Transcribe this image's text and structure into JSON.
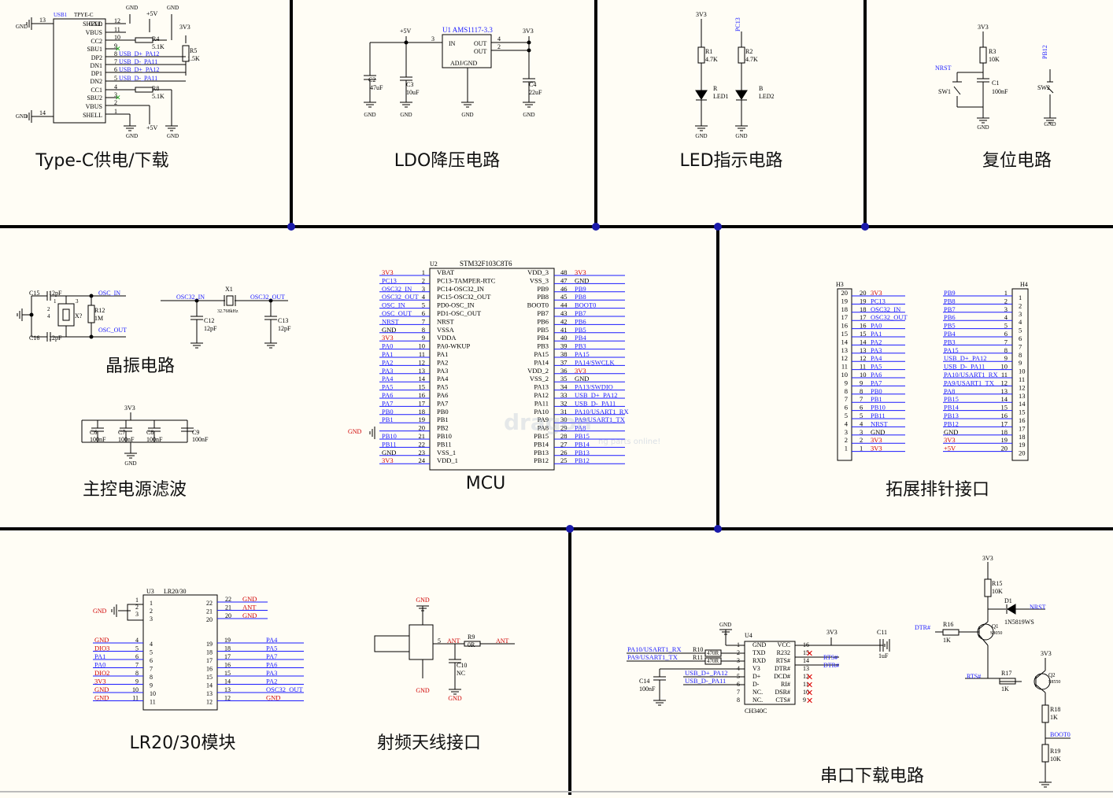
{
  "sections": {
    "typec": "Type-C供电/下载",
    "ldo": "LDO降压电路",
    "led": "LED指示电路",
    "reset": "复位电路",
    "crystal": "晶振电路",
    "mcu": "MCU",
    "header": "拓展排针接口",
    "filter": "主控电源滤波",
    "lr": "LR20/30模块",
    "rf": "射频天线接口",
    "serial": "串口下载电路"
  },
  "watermark": {
    "brand": "dragon",
    "tagline": "ng parts online!"
  },
  "typec": {
    "ref": "USB1",
    "part": "TPYE-C",
    "left_pins": [
      "SHELL",
      "VBUS",
      "CC2",
      "SBU1",
      "DP2",
      "DN1",
      "DP1",
      "DN2",
      "CC1",
      "SBU2",
      "VBUS",
      "SHELL"
    ],
    "right_pins": [
      "GND",
      "",
      "",
      "",
      "",
      "",
      "",
      "",
      "",
      "",
      "",
      "GND"
    ],
    "pin_nums": [
      "12",
      "11",
      "10",
      "9",
      "8",
      "7",
      "6",
      "5",
      "4",
      "3",
      "2",
      "1"
    ],
    "nets": [
      "",
      "",
      "",
      "",
      "USB_D+_PA12",
      "USB_D-_PA11",
      "USB_D+_PA12",
      "USB_D-_PA11",
      "",
      "",
      "",
      ""
    ],
    "gnd": "GND",
    "v5": "+5V",
    "v33": "3V3",
    "r4": "R4",
    "r4v": "5.1K",
    "r8": "R8",
    "r8v": "5.1K",
    "r5": "R5",
    "r5v": "1.5K",
    "shell_pins": [
      "13",
      "14"
    ]
  },
  "ldo": {
    "ref": "U1",
    "part": "AMS1117-3.3",
    "pins": [
      "IN",
      "OUT",
      "OUT",
      "ADJ/GND"
    ],
    "pin_nums": [
      "3",
      "4",
      "2"
    ],
    "v5": "+5V",
    "v33": "3V3",
    "c2": "C2",
    "c2v": "47uF",
    "c3": "C3",
    "c3v": "10uF",
    "c4": "C4",
    "c4v": "22uF",
    "gnd": "GND"
  },
  "led": {
    "v33": "3V3",
    "pc13": "PC13",
    "r1": "R1",
    "r1v": "4.7K",
    "r2": "R2",
    "r2v": "4.7K",
    "led1": "LED1",
    "led1c": "R",
    "led2": "LED2",
    "led2c": "B",
    "gnd": "GND"
  },
  "reset": {
    "v33": "3V3",
    "r3": "R3",
    "r3v": "10K",
    "nrst": "NRST",
    "sw1": "SW1",
    "c1": "C1",
    "c1v": "100nF",
    "pb12": "PB12",
    "sw2": "SW2",
    "gnd": "GND"
  },
  "crystal": {
    "c15": "C15",
    "c15v": "12pF",
    "c16": "C16",
    "c16v": "12pF",
    "x2": "X?",
    "r12": "R12",
    "r12v": "1M",
    "osc_in": "OSC_IN",
    "osc_out": "OSC_OUT",
    "pins": [
      "1",
      "2",
      "3",
      "4"
    ],
    "x1": "X1",
    "x1v": "32.768kHz",
    "osc32_in": "OSC32_IN",
    "osc32_out": "OSC32_OUT",
    "c12": "C12",
    "c12v": "12pF",
    "c13": "C13",
    "c13v": "12pF"
  },
  "filter": {
    "v33": "3V3",
    "gnd": "GND",
    "caps": [
      {
        "ref": "C6",
        "val": "100nF"
      },
      {
        "ref": "C7",
        "val": "100nF"
      },
      {
        "ref": "C8",
        "val": "100nF"
      },
      {
        "ref": "C9",
        "val": "100nF"
      }
    ]
  },
  "mcu": {
    "ref": "U2",
    "part": "STM32F103C8T6",
    "gnd": "GND",
    "left": [
      {
        "net": "3V3",
        "num": "1",
        "pin": "VBAT",
        "c": "red"
      },
      {
        "net": "PC13",
        "num": "2",
        "pin": "PC13-TAMPER-RTC",
        "c": "blue"
      },
      {
        "net": "OSC32_IN",
        "num": "3",
        "pin": "PC14-OSC32_IN",
        "c": "blue"
      },
      {
        "net": "OSC32_OUT",
        "num": "4",
        "pin": "PC15-OSC32_OUT",
        "c": "blue"
      },
      {
        "net": "OSC_IN",
        "num": "5",
        "pin": "PD0-OSC_IN",
        "c": "blue"
      },
      {
        "net": "OSC_OUT",
        "num": "6",
        "pin": "PD1-OSC_OUT",
        "c": "blue"
      },
      {
        "net": "NRST",
        "num": "7",
        "pin": "NRST",
        "c": "blue"
      },
      {
        "net": "GND",
        "num": "8",
        "pin": "VSSA",
        "c": "blk"
      },
      {
        "net": "3V3",
        "num": "9",
        "pin": "VDDA",
        "c": "red"
      },
      {
        "net": "PA0",
        "num": "10",
        "pin": "PA0-WKUP",
        "c": "blue"
      },
      {
        "net": "PA1",
        "num": "11",
        "pin": "PA1",
        "c": "blue"
      },
      {
        "net": "PA2",
        "num": "12",
        "pin": "PA2",
        "c": "blue"
      },
      {
        "net": "PA3",
        "num": "13",
        "pin": "PA3",
        "c": "blue"
      },
      {
        "net": "PA4",
        "num": "14",
        "pin": "PA4",
        "c": "blue"
      },
      {
        "net": "PA5",
        "num": "15",
        "pin": "PA5",
        "c": "blue"
      },
      {
        "net": "PA6",
        "num": "16",
        "pin": "PA6",
        "c": "blue"
      },
      {
        "net": "PA7",
        "num": "17",
        "pin": "PA7",
        "c": "blue"
      },
      {
        "net": "PB0",
        "num": "18",
        "pin": "PB0",
        "c": "blue"
      },
      {
        "net": "PB1",
        "num": "19",
        "pin": "PB1",
        "c": "blue"
      },
      {
        "net": "",
        "num": "20",
        "pin": "PB2",
        "c": "blk"
      },
      {
        "net": "PB10",
        "num": "21",
        "pin": "PB10",
        "c": "blue"
      },
      {
        "net": "PB11",
        "num": "22",
        "pin": "PB11",
        "c": "blue"
      },
      {
        "net": "GND",
        "num": "23",
        "pin": "VSS_1",
        "c": "blk"
      },
      {
        "net": "3V3",
        "num": "24",
        "pin": "VDD_1",
        "c": "red"
      }
    ],
    "right": [
      {
        "net": "3V3",
        "num": "48",
        "pin": "VDD_3",
        "c": "red"
      },
      {
        "net": "GND",
        "num": "47",
        "pin": "VSS_3",
        "c": "blk"
      },
      {
        "net": "PB9",
        "num": "46",
        "pin": "PB9",
        "c": "blue"
      },
      {
        "net": "PB8",
        "num": "45",
        "pin": "PB8",
        "c": "blue"
      },
      {
        "net": "BOOT0",
        "num": "44",
        "pin": "BOOT0",
        "c": "blue"
      },
      {
        "net": "PB7",
        "num": "43",
        "pin": "PB7",
        "c": "blue"
      },
      {
        "net": "PB6",
        "num": "42",
        "pin": "PB6",
        "c": "blue"
      },
      {
        "net": "PB5",
        "num": "41",
        "pin": "PB5",
        "c": "blue"
      },
      {
        "net": "PB4",
        "num": "40",
        "pin": "PB4",
        "c": "blue"
      },
      {
        "net": "PB3",
        "num": "39",
        "pin": "PB3",
        "c": "blue"
      },
      {
        "net": "PA15",
        "num": "38",
        "pin": "PA15",
        "c": "blue"
      },
      {
        "net": "PA14/SWCLK",
        "num": "37",
        "pin": "PA14",
        "c": "blue"
      },
      {
        "net": "3V3",
        "num": "36",
        "pin": "VDD_2",
        "c": "red"
      },
      {
        "net": "GND",
        "num": "35",
        "pin": "VSS_2",
        "c": "blk"
      },
      {
        "net": "PA13/SWDIO",
        "num": "34",
        "pin": "PA13",
        "c": "blue"
      },
      {
        "net": "USB_D+_PA12",
        "num": "33",
        "pin": "PA12",
        "c": "blue"
      },
      {
        "net": "USB_D-_PA11",
        "num": "32",
        "pin": "PA11",
        "c": "blue"
      },
      {
        "net": "PA10/USART1_RX",
        "num": "31",
        "pin": "PA10",
        "c": "blue"
      },
      {
        "net": "PA9/USART1_TX",
        "num": "30",
        "pin": "PA9",
        "c": "blue"
      },
      {
        "net": "PA8",
        "num": "29",
        "pin": "PA8",
        "c": "blue"
      },
      {
        "net": "PB15",
        "num": "28",
        "pin": "PB15",
        "c": "blue"
      },
      {
        "net": "PB14",
        "num": "27",
        "pin": "PB14",
        "c": "blue"
      },
      {
        "net": "PB13",
        "num": "26",
        "pin": "PB13",
        "c": "blue"
      },
      {
        "net": "PB12",
        "num": "25",
        "pin": "PB12",
        "c": "blue"
      }
    ]
  },
  "header": {
    "h3": "H3",
    "h4": "H4",
    "h3_rows": [
      {
        "n": "20",
        "net": "3V3",
        "c": "red"
      },
      {
        "n": "19",
        "net": "PC13",
        "c": "blue"
      },
      {
        "n": "18",
        "net": "OSC32_IN",
        "c": "blue"
      },
      {
        "n": "17",
        "net": "OSC32_OUT",
        "c": "blue"
      },
      {
        "n": "16",
        "net": "PA0",
        "c": "blue"
      },
      {
        "n": "15",
        "net": "PA1",
        "c": "blue"
      },
      {
        "n": "14",
        "net": "PA2",
        "c": "blue"
      },
      {
        "n": "13",
        "net": "PA3",
        "c": "blue"
      },
      {
        "n": "12",
        "net": "PA4",
        "c": "blue"
      },
      {
        "n": "11",
        "net": "PA5",
        "c": "blue"
      },
      {
        "n": "10",
        "net": "PA6",
        "c": "blue"
      },
      {
        "n": "9",
        "net": "PA7",
        "c": "blue"
      },
      {
        "n": "8",
        "net": "PB0",
        "c": "blue"
      },
      {
        "n": "7",
        "net": "PB1",
        "c": "blue"
      },
      {
        "n": "6",
        "net": "PB10",
        "c": "blue"
      },
      {
        "n": "5",
        "net": "PB11",
        "c": "blue"
      },
      {
        "n": "4",
        "net": "NRST",
        "c": "blue"
      },
      {
        "n": "3",
        "net": "GND",
        "c": "blk"
      },
      {
        "n": "2",
        "net": "3V3",
        "c": "red"
      },
      {
        "n": "1",
        "net": "3V3",
        "c": "red"
      }
    ],
    "h4_rows": [
      {
        "n": "1",
        "net": "PB9",
        "c": "blue"
      },
      {
        "n": "2",
        "net": "PB8",
        "c": "blue"
      },
      {
        "n": "3",
        "net": "PB7",
        "c": "blue"
      },
      {
        "n": "4",
        "net": "PB6",
        "c": "blue"
      },
      {
        "n": "5",
        "net": "PB5",
        "c": "blue"
      },
      {
        "n": "6",
        "net": "PB4",
        "c": "blue"
      },
      {
        "n": "7",
        "net": "PB3",
        "c": "blue"
      },
      {
        "n": "8",
        "net": "PA15",
        "c": "blue"
      },
      {
        "n": "9",
        "net": "USB_D+_PA12",
        "c": "blue"
      },
      {
        "n": "10",
        "net": "USB_D-_PA11",
        "c": "blue"
      },
      {
        "n": "11",
        "net": "PA10/USART1_RX",
        "c": "blue"
      },
      {
        "n": "12",
        "net": "PA9/USART1_TX",
        "c": "blue"
      },
      {
        "n": "13",
        "net": "PA8",
        "c": "blue"
      },
      {
        "n": "14",
        "net": "PB15",
        "c": "blue"
      },
      {
        "n": "15",
        "net": "PB14",
        "c": "blue"
      },
      {
        "n": "16",
        "net": "PB13",
        "c": "blue"
      },
      {
        "n": "17",
        "net": "PB12",
        "c": "blue"
      },
      {
        "n": "18",
        "net": "GND",
        "c": "blk"
      },
      {
        "n": "19",
        "net": "3V3",
        "c": "red"
      },
      {
        "n": "20",
        "net": "+5V",
        "c": "red"
      }
    ]
  },
  "lr": {
    "ref": "U3",
    "part": "LR20/30",
    "gnd": "GND",
    "top_left": [
      "1",
      "2",
      "3"
    ],
    "top_right": [
      {
        "n": "22",
        "net": "GND"
      },
      {
        "n": "21",
        "net": "ANT"
      },
      {
        "n": "20",
        "net": "GND"
      }
    ],
    "left": [
      {
        "net": "GND",
        "n": "4",
        "c": "red"
      },
      {
        "net": "DIO3",
        "n": "5",
        "c": "red"
      },
      {
        "net": "PA1",
        "n": "6",
        "c": "blue"
      },
      {
        "net": "PA0",
        "n": "7",
        "c": "blue"
      },
      {
        "net": "DIO2",
        "n": "8",
        "c": "red"
      },
      {
        "net": "3V3",
        "n": "9",
        "c": "red"
      },
      {
        "net": "GND",
        "n": "10",
        "c": "red"
      },
      {
        "net": "GND",
        "n": "11",
        "c": "red"
      }
    ],
    "right": [
      {
        "net": "PA4",
        "n": "19",
        "c": "blue"
      },
      {
        "net": "PA5",
        "n": "18",
        "c": "blue"
      },
      {
        "net": "PA7",
        "n": "17",
        "c": "blue"
      },
      {
        "net": "PA6",
        "n": "16",
        "c": "blue"
      },
      {
        "net": "PA3",
        "n": "15",
        "c": "blue"
      },
      {
        "net": "PA2",
        "n": "14",
        "c": "blue"
      },
      {
        "net": "OSC32_OUT",
        "n": "13",
        "c": "blue"
      },
      {
        "net": "GND",
        "n": "12",
        "c": "red"
      }
    ]
  },
  "rf": {
    "gnd": "GND",
    "ant": "ANT",
    "r9": "R9",
    "r9v": "0R",
    "c10": "C10",
    "c10v": "NC",
    "pin5": "5"
  },
  "serial": {
    "ref": "U4",
    "part": "CH340C",
    "gnd": "GND",
    "v33": "3V3",
    "c11": "C11",
    "c11v": "1uF",
    "c14": "C14",
    "c14v": "100nF",
    "r10": "R10",
    "r11": "R11",
    "r10v": "470R",
    "r11v": "470R",
    "left_nets": [
      "PA10/USART1_RX",
      "PA9/USART1_TX",
      "USB_D+_PA12",
      "USB_D-_PA11"
    ],
    "left_pins": [
      {
        "n": "1",
        "p": "GND"
      },
      {
        "n": "2",
        "p": "TXD"
      },
      {
        "n": "3",
        "p": "RXD"
      },
      {
        "n": "4",
        "p": "V3"
      },
      {
        "n": "5",
        "p": "D+"
      },
      {
        "n": "6",
        "p": "D-"
      },
      {
        "n": "7",
        "p": "NC."
      },
      {
        "n": "8",
        "p": "NC."
      }
    ],
    "right_pins": [
      {
        "n": "16",
        "p": "VCC"
      },
      {
        "n": "15",
        "p": "R232"
      },
      {
        "n": "14",
        "p": "RTS#"
      },
      {
        "n": "13",
        "p": "DTR#"
      },
      {
        "n": "12",
        "p": "DCD#"
      },
      {
        "n": "11",
        "p": "RI#"
      },
      {
        "n": "10",
        "p": "DSR#"
      },
      {
        "n": "9",
        "p": "CTS#"
      }
    ],
    "rts": "RTS#",
    "dtr": "DTR#",
    "r15": "R15",
    "r15v": "10K",
    "d1": "D1",
    "d1v": "1N5819WS",
    "nrst": "NRST",
    "r16": "R16",
    "r16v": "1K",
    "q1": "Q1",
    "q1v": "S8050",
    "r17": "R17",
    "r17v": "1K",
    "q2": "Q2",
    "q2v": "S8550",
    "r18": "R18",
    "r18v": "1K",
    "boot0": "BOOT0",
    "r19": "R19",
    "r19v": "10K"
  },
  "colors": {
    "net_blue": "#1a1aff",
    "net_red": "#d00000",
    "divider": "#000000",
    "junction": "#1a1aaa",
    "paper": "#fffdf5"
  }
}
